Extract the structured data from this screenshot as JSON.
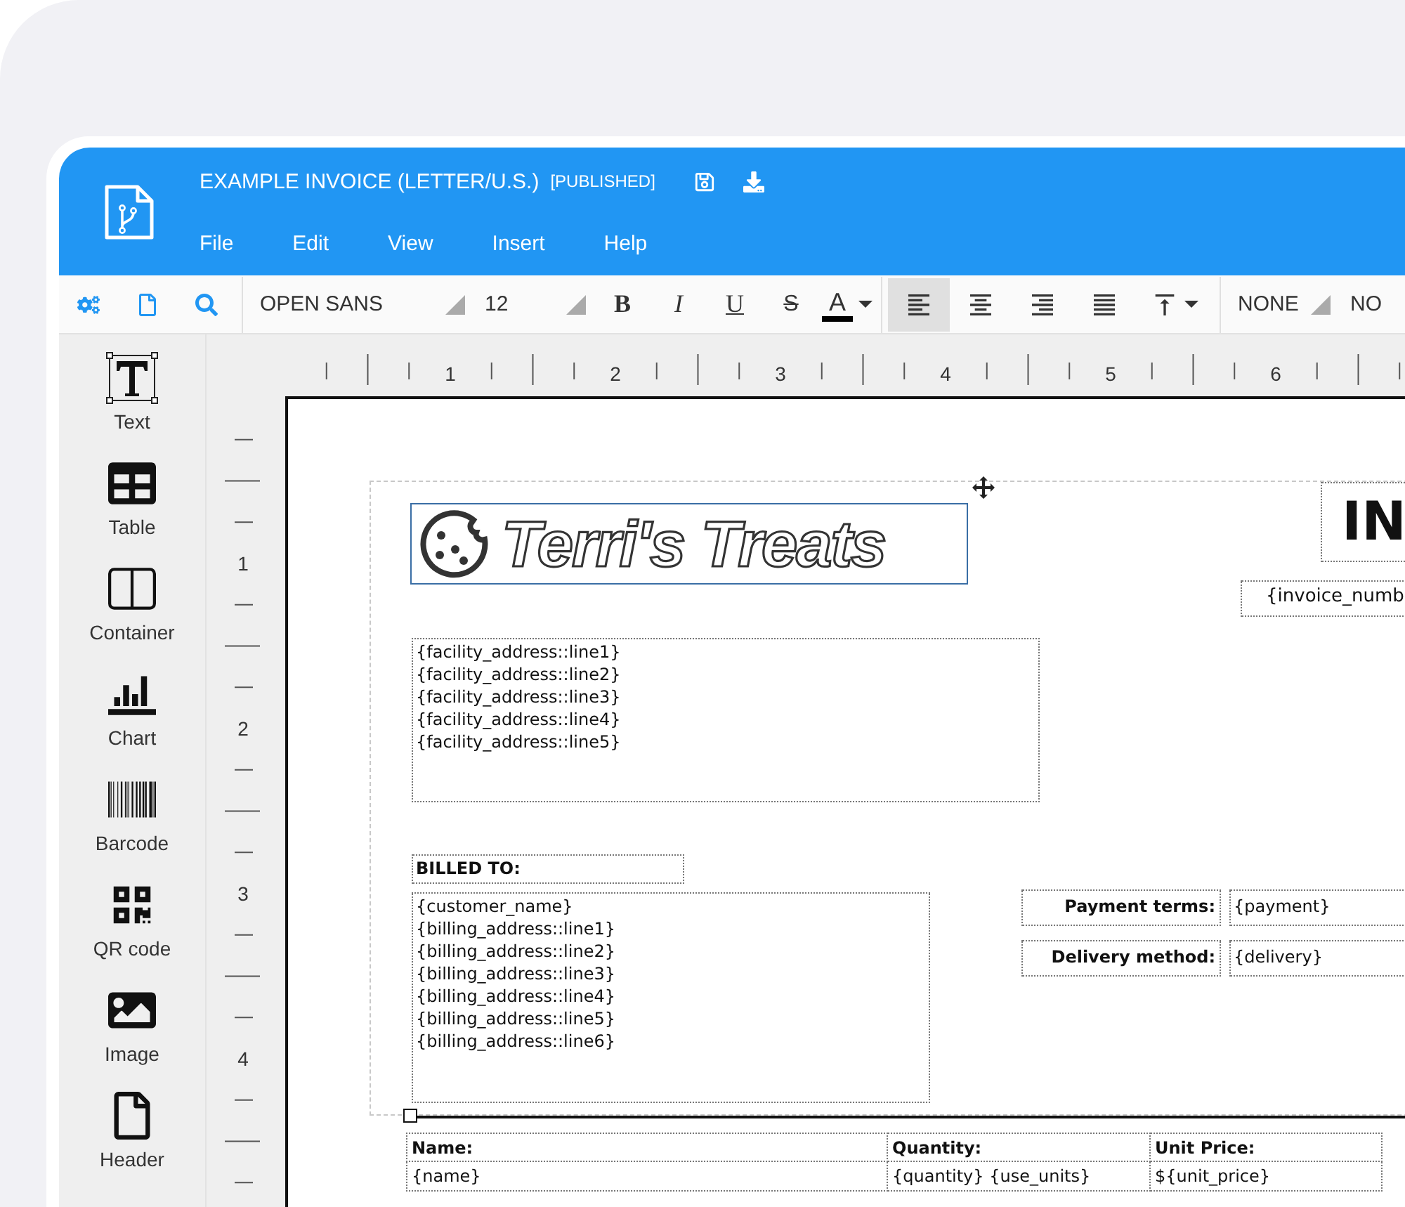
{
  "window": {
    "title": "EXAMPLE INVOICE (LETTER/U.S.)",
    "status": "[PUBLISHED]"
  },
  "menu": [
    "File",
    "Edit",
    "View",
    "Insert",
    "Help"
  ],
  "toolbar": {
    "font": "OPEN SANS",
    "size": "12",
    "format": [
      {
        "kind": "bold",
        "label": "B"
      },
      {
        "kind": "italic",
        "label": "I"
      },
      {
        "kind": "underline",
        "label": "U"
      },
      {
        "kind": "strike",
        "label": "S"
      },
      {
        "kind": "color",
        "label": "A"
      }
    ],
    "align": [
      {
        "kind": "left",
        "selected": true
      },
      {
        "kind": "center",
        "selected": false
      },
      {
        "kind": "right",
        "selected": false
      },
      {
        "kind": "justify",
        "selected": false
      },
      {
        "kind": "valign",
        "selected": false
      }
    ],
    "border": "NONE",
    "border_2": "NO"
  },
  "sidebar": {
    "items": [
      {
        "kind": "text",
        "label": "Text"
      },
      {
        "kind": "table",
        "label": "Table"
      },
      {
        "kind": "container",
        "label": "Container"
      },
      {
        "kind": "chart",
        "label": "Chart"
      },
      {
        "kind": "barcode",
        "label": "Barcode"
      },
      {
        "kind": "qr",
        "label": "QR code"
      },
      {
        "kind": "image",
        "label": "Image"
      },
      {
        "kind": "header",
        "label": "Header"
      }
    ]
  },
  "ruler": {
    "horizontal": [
      "1",
      "2",
      "3",
      "4",
      "5",
      "6"
    ],
    "vertical": [
      "1",
      "2",
      "3",
      "4"
    ]
  },
  "document": {
    "logo": "Terri's Treats",
    "title": "IN",
    "invoice_number": "{invoice_numb",
    "facility_address": [
      "{facility_address::line1}",
      "{facility_address::line2}",
      "{facility_address::line3}",
      "{facility_address::line4}",
      "{facility_address::line5}"
    ],
    "billed_to": "BILLED TO:",
    "customer": [
      "{customer_name}",
      "{billing_address::line1}",
      "{billing_address::line2}",
      "{billing_address::line3}",
      "{billing_address::line4}",
      "{billing_address::line5}",
      "{billing_address::line6}"
    ],
    "fields": [
      {
        "label": "Payment terms:",
        "value": "{payment}"
      },
      {
        "label": "Delivery method:",
        "value": "{delivery}"
      }
    ],
    "table": {
      "columns": [
        "Name:",
        "Quantity:",
        "Unit Price:"
      ],
      "rows": [
        [
          "{name}",
          "{quantity} {use_units}",
          "${unit_price}"
        ]
      ]
    }
  }
}
